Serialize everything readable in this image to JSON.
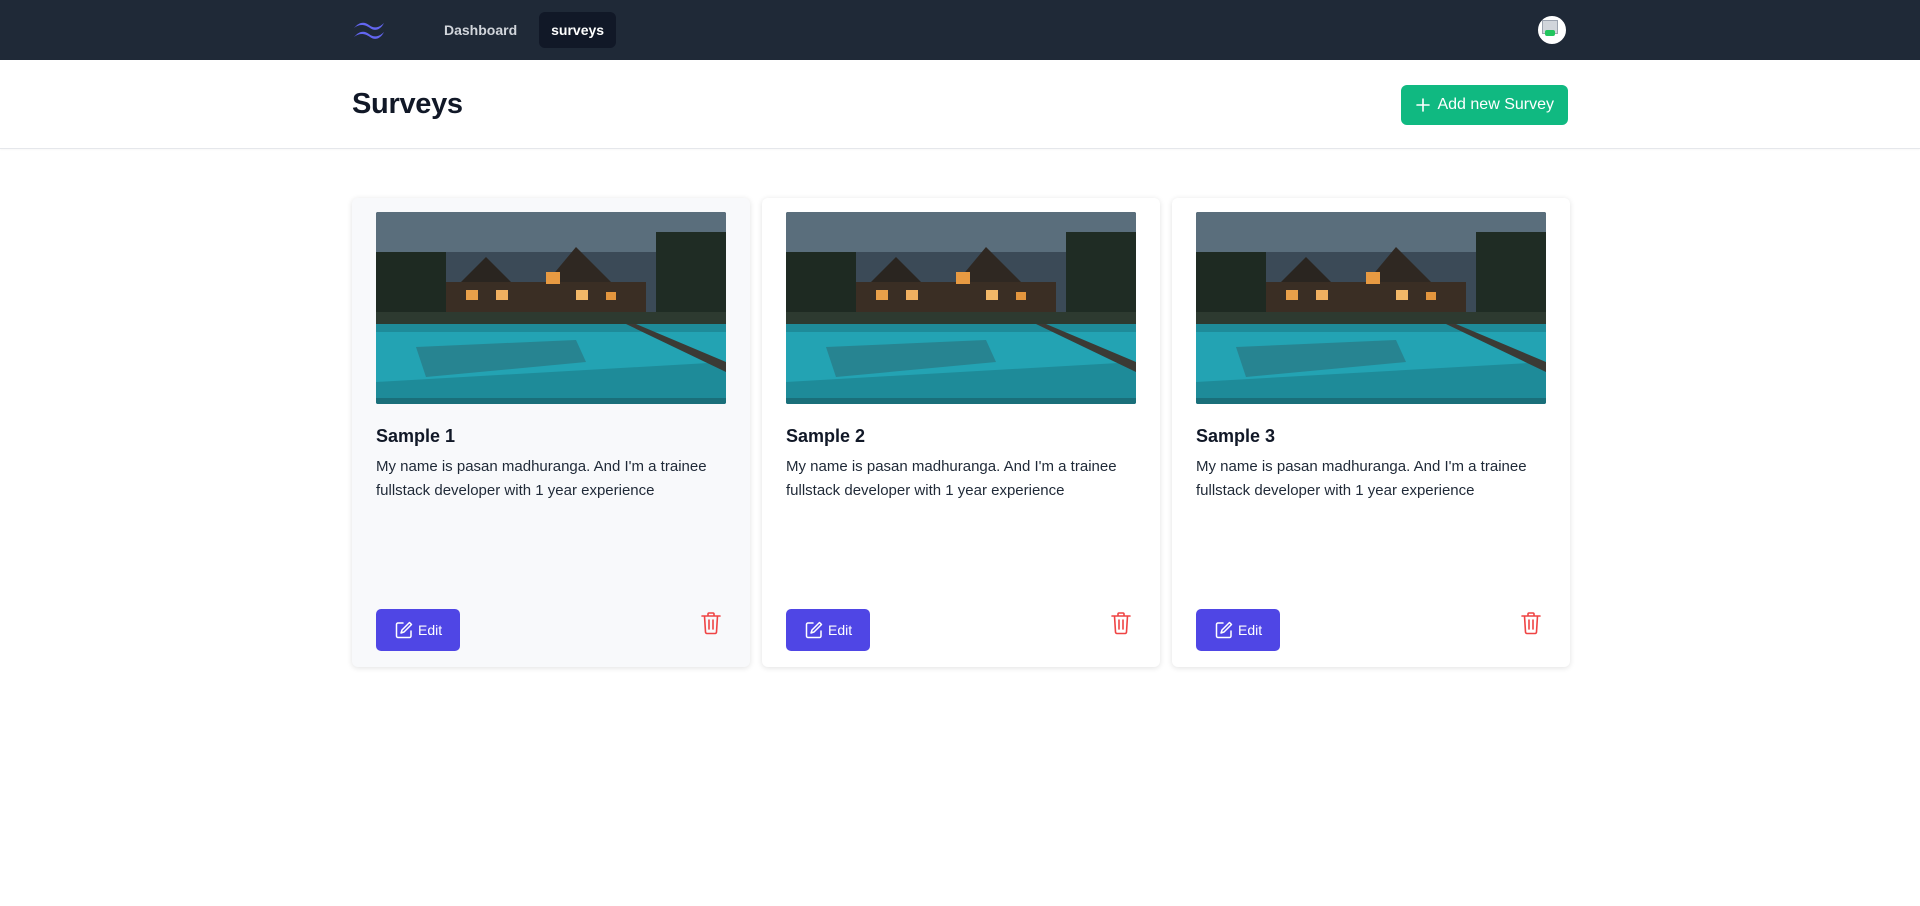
{
  "nav": {
    "links": [
      {
        "label": "Dashboard",
        "active": false
      },
      {
        "label": "surveys",
        "active": true
      }
    ],
    "logo_icon": "wave-logo-icon",
    "avatar_icon": "user-avatar"
  },
  "header": {
    "title": "Surveys",
    "add_button_label": "Add new Survey",
    "add_icon": "plus-icon"
  },
  "surveys": [
    {
      "title": "Sample 1",
      "description": "My name is pasan madhuranga. And I'm a trainee fullstack developer with 1 year experience",
      "edit_label": "Edit"
    },
    {
      "title": "Sample 2",
      "description": "My name is pasan madhuranga. And I'm a trainee fullstack developer with 1 year experience",
      "edit_label": "Edit"
    },
    {
      "title": "Sample 3",
      "description": "My name is pasan madhuranga. And I'm a trainee fullstack developer with 1 year experience",
      "edit_label": "Edit"
    }
  ],
  "colors": {
    "nav_bg": "#1f2937",
    "add_button": "#10b981",
    "edit_button": "#4f46e5",
    "delete_icon": "#ef4444"
  }
}
